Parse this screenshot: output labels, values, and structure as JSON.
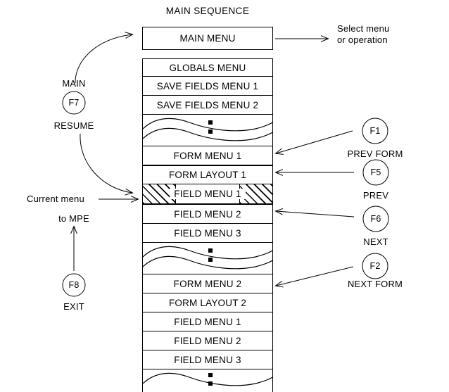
{
  "diagram": {
    "title": "MAIN SEQUENCE",
    "top_note": {
      "line1": "Select menu",
      "line2": "or operation"
    },
    "current_menu_label": "Current menu",
    "to_mpe_label": "to MPE"
  },
  "sequence": {
    "main_menu": "MAIN MENU",
    "rows": [
      {
        "id": "globals-menu",
        "label": "GLOBALS MENU"
      },
      {
        "id": "save-fields-1",
        "label": "SAVE FIELDS MENU 1"
      },
      {
        "id": "save-fields-2",
        "label": "SAVE FIELDS MENU 2"
      },
      {
        "id": "form-menu-1",
        "label": "FORM MENU 1"
      },
      {
        "id": "form-layout-1",
        "label": "FORM LAYOUT 1"
      },
      {
        "id": "field-menu-1a",
        "label": "FIELD MENU 1"
      },
      {
        "id": "field-menu-2a",
        "label": "FIELD MENU 2"
      },
      {
        "id": "field-menu-3a",
        "label": "FIELD MENU 3"
      },
      {
        "id": "form-menu-2",
        "label": "FORM MENU 2"
      },
      {
        "id": "form-layout-2",
        "label": "FORM LAYOUT 2"
      },
      {
        "id": "field-menu-1b",
        "label": "FIELD MENU 1"
      },
      {
        "id": "field-menu-2b",
        "label": "FIELD MENU 2"
      },
      {
        "id": "field-menu-3b",
        "label": "FIELD MENU 3"
      }
    ]
  },
  "function_keys": {
    "main_resume": {
      "key": "F7",
      "above": "MAIN",
      "below": "RESUME"
    },
    "exit": {
      "key": "F8",
      "below": "EXIT"
    },
    "prev_form": {
      "key": "F1",
      "below": "PREV FORM"
    },
    "prev": {
      "key": "F5",
      "below": "PREV"
    },
    "next": {
      "key": "F6",
      "below": "NEXT"
    },
    "next_form": {
      "key": "F2",
      "below": "NEXT FORM"
    }
  },
  "colors": {
    "line": "#000000",
    "background": "#ffffff"
  }
}
